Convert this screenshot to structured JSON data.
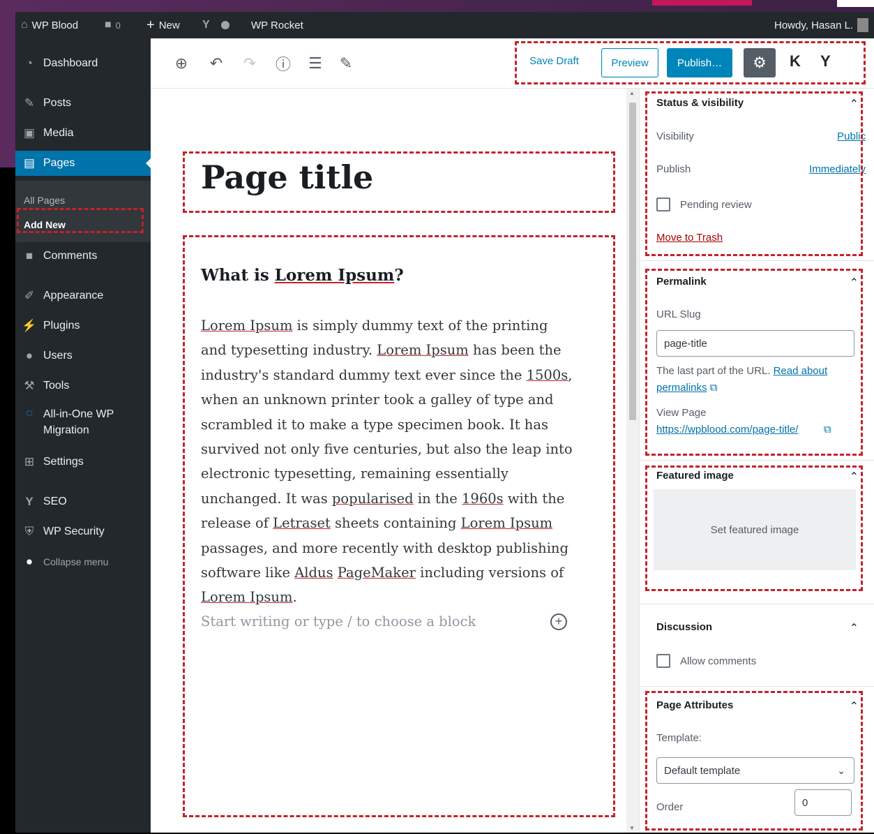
{
  "admin_bar": {
    "site_name": "WP Blood",
    "comments_count": "0",
    "new_label": "New",
    "wp_rocket": "WP Rocket",
    "howdy": "Howdy, Hasan L."
  },
  "menu": {
    "dashboard": "Dashboard",
    "posts": "Posts",
    "media": "Media",
    "pages": "Pages",
    "all_pages": "All Pages",
    "add_new": "Add New",
    "comments": "Comments",
    "appearance": "Appearance",
    "plugins": "Plugins",
    "users": "Users",
    "tools": "Tools",
    "migration_line1": "All-in-One WP",
    "migration_line2": "Migration",
    "settings": "Settings",
    "seo": "SEO",
    "wp_security": "WP Security",
    "collapse": "Collapse menu"
  },
  "toolbar": {
    "save_draft": "Save Draft",
    "preview": "Preview",
    "publish": "Publish…"
  },
  "content": {
    "title": "Page title",
    "heading_prefix": "What is ",
    "heading_link": "Lorem Ipsum",
    "heading_suffix": "?",
    "placeholder": "Start writing or type / to choose a block"
  },
  "sidebar": {
    "status_title": "Status & visibility",
    "visibility_label": "Visibility",
    "visibility_value": "Public",
    "publish_label": "Publish",
    "publish_value": "Immediately",
    "pending_review": "Pending review",
    "move_to_trash": "Move to Trash",
    "permalink_title": "Permalink",
    "url_slug_label": "URL Slug",
    "url_slug_value": "page-title",
    "url_help": "The last part of the URL.",
    "read_about": "Read about",
    "permalinks": "permalinks",
    "view_page_label": "View Page",
    "view_page_url": "https://wpblood.com/page-title/",
    "featured_title": "Featured image",
    "set_featured": "Set featured image",
    "discussion_title": "Discussion",
    "allow_comments": "Allow comments",
    "attributes_title": "Page Attributes",
    "template_label": "Template:",
    "template_value": "Default template",
    "order_label": "Order",
    "order_value": "0"
  }
}
